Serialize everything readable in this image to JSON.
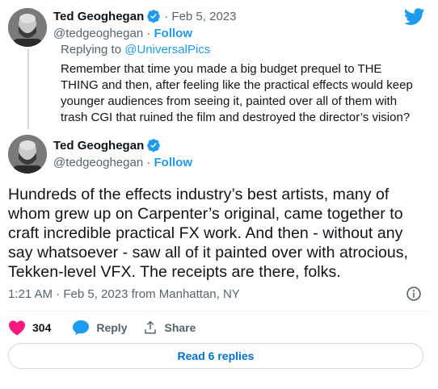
{
  "reply_tweet": {
    "author_name": "Ted Geoghegan",
    "date": "Feb 5, 2023",
    "handle": "@tedgeoghegan",
    "follow_label": "Follow",
    "replying_prefix": "Replying to",
    "replying_to": "@UniversalPics",
    "text": "Remember that time you made a big budget prequel to THE THING and then, after feeling like the practical effects would keep younger audiences from seeing it, painted over all of them with trash CGI that ruined the film and destroyed the director’s vision?"
  },
  "main_tweet": {
    "author_name": "Ted Geoghegan",
    "handle": "@tedgeoghegan",
    "follow_label": "Follow",
    "text": "Hundreds of the effects industry’s best artists, many of whom grew up on Carpenter’s original, came together to craft incredible practical FX work. And then - without any say whatsoever - saw all of it painted over with atrocious, Tekken-level VFX. The receipts are there, folks.",
    "timestamp": "1:21 AM · Feb 5, 2023 from Manhattan, NY"
  },
  "actions": {
    "likes_count": "304",
    "reply_label": "Reply",
    "share_label": "Share"
  },
  "read_replies_label": "Read 6 replies",
  "colors": {
    "accent": "#1d9bf0",
    "like": "#f91880",
    "muted": "#536471"
  },
  "icons": [
    "twitter-bird-icon",
    "verified-badge-icon",
    "info-icon",
    "heart-icon",
    "reply-bubble-icon",
    "share-icon"
  ]
}
